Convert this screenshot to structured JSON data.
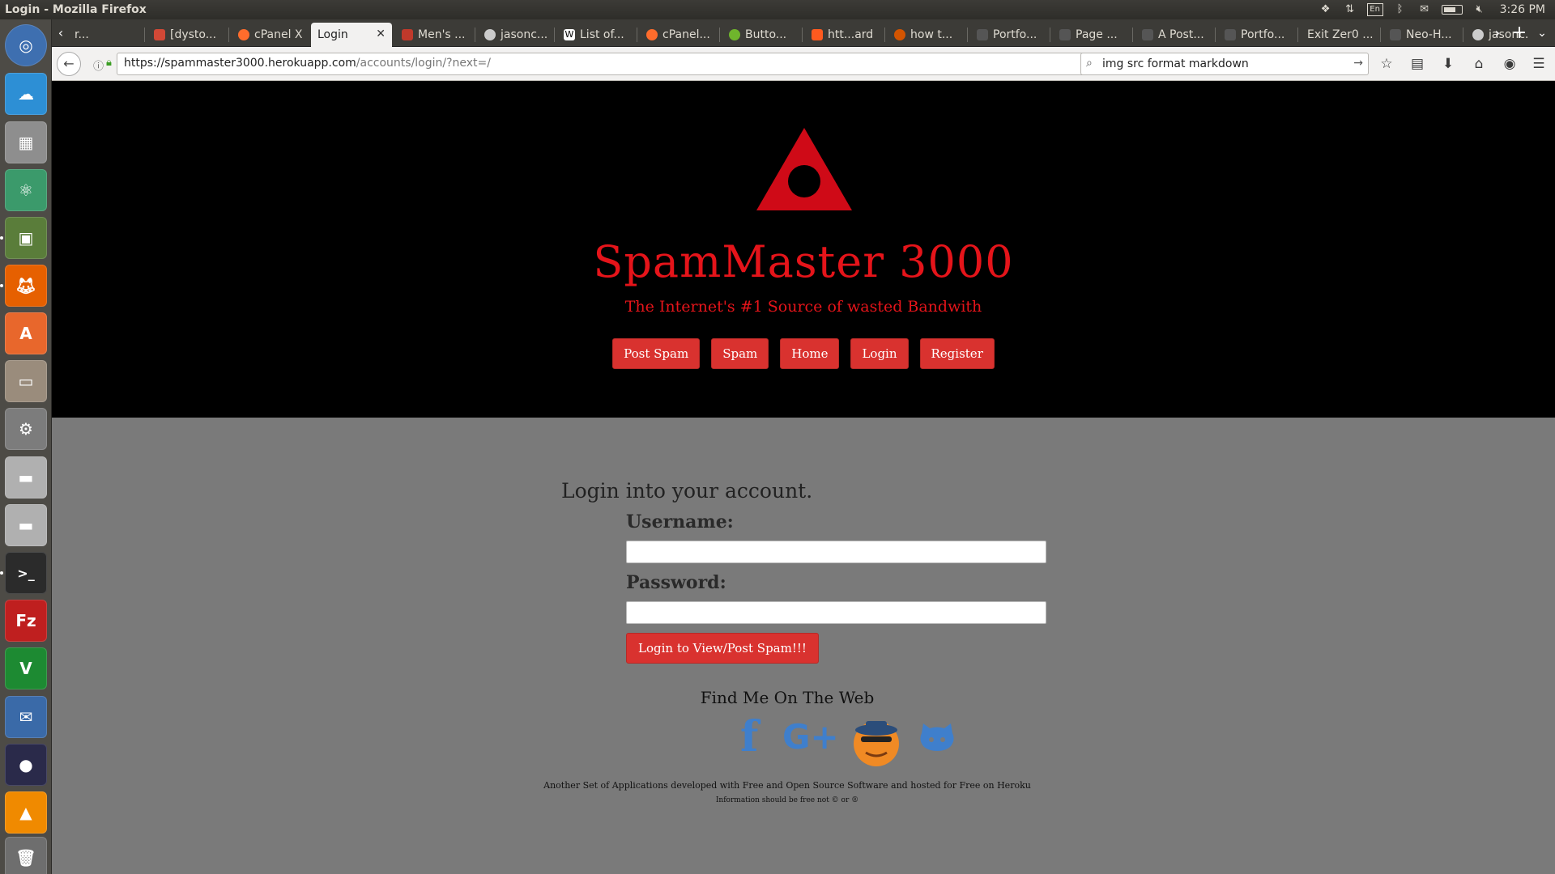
{
  "window": {
    "title": "Login - Mozilla Firefox"
  },
  "system_tray": {
    "keyboard_layout": "En",
    "clock": "3:26 PM",
    "icons": [
      "dropbox-icon",
      "network-icon",
      "keyboard-icon",
      "bluetooth-icon",
      "mail-icon",
      "battery-icon",
      "volume-muted-icon"
    ]
  },
  "launcher": {
    "items": [
      "ubuntu-dash-icon",
      "cloud-icon",
      "calculator-icon",
      "atom-icon",
      "rubiks-cube-icon",
      "firefox-icon",
      "software-center-icon",
      "files-icon",
      "system-settings-icon",
      "drive-icon",
      "drive-icon",
      "terminal-icon",
      "filezilla-icon",
      "vim-icon",
      "thunderbird-icon",
      "color-balls-icon",
      "vlc-icon",
      "trash-icon"
    ]
  },
  "tabs": [
    {
      "label": "r...",
      "icon": "blank-tab-icon",
      "active": false
    },
    {
      "label": "[dysto...",
      "icon": "gmail-icon",
      "active": false
    },
    {
      "label": "cPanel X",
      "icon": "cpanel-icon",
      "active": false
    },
    {
      "label": "Login",
      "icon": "",
      "active": true
    },
    {
      "label": "Men's ...",
      "icon": "site-icon",
      "active": false
    },
    {
      "label": "jasonc...",
      "icon": "github-icon",
      "active": false
    },
    {
      "label": "List of...",
      "icon": "wikipedia-icon",
      "active": false
    },
    {
      "label": "cPanel...",
      "icon": "cpanel-icon",
      "active": false
    },
    {
      "label": "Butto...",
      "icon": "site-icon",
      "active": false
    },
    {
      "label": "htt...ard",
      "icon": "site-icon",
      "active": false
    },
    {
      "label": "how t...",
      "icon": "site-icon",
      "active": false
    },
    {
      "label": "Portfo...",
      "icon": "blank-tab-icon",
      "active": false
    },
    {
      "label": "Page ...",
      "icon": "blank-tab-icon",
      "active": false
    },
    {
      "label": "A Post...",
      "icon": "blank-tab-icon",
      "active": false
    },
    {
      "label": "Portfo...",
      "icon": "blank-tab-icon",
      "active": false
    },
    {
      "label": "Exit Zer0 ...",
      "icon": "",
      "active": false
    },
    {
      "label": "Neo-H...",
      "icon": "blank-tab-icon",
      "active": false
    },
    {
      "label": "jasonc...",
      "icon": "github-icon",
      "active": false
    }
  ],
  "navbar": {
    "url_host": "https://spammaster3000.herokuapp.com",
    "url_path": "/accounts/login/?next=/",
    "search_value": "img src format markdown"
  },
  "site": {
    "title": "SpamMaster 3000",
    "tagline": "The Internet's #1 Source of wasted Bandwith",
    "nav": [
      "Post Spam",
      "Spam",
      "Home",
      "Login",
      "Register"
    ],
    "brand_color": "#e5141a",
    "button_color": "#d9322f"
  },
  "login": {
    "heading": "Login into your account.",
    "username_label": "Username:",
    "username_value": "",
    "password_label": "Password:",
    "password_value": "",
    "submit_label": "Login to View/Post Spam!!!"
  },
  "social": {
    "heading": "Find Me On The Web",
    "icons": [
      "facebook-icon",
      "google-plus-icon",
      "spy-mascot-icon",
      "github-icon"
    ]
  },
  "footer": {
    "line1": "Another Set of Applications developed with Free and Open Source Software and hosted for Free on Heroku",
    "line2": "Information should be free not © or ®"
  }
}
